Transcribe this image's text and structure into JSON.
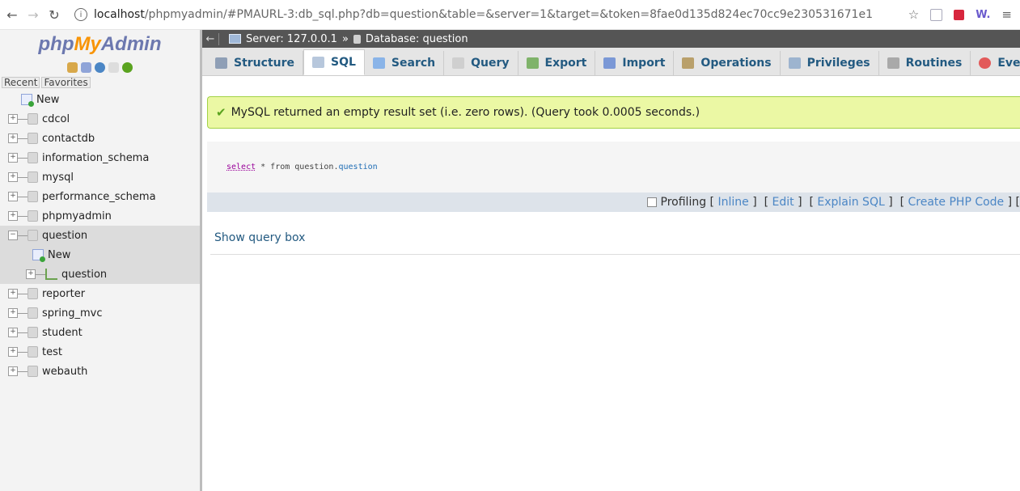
{
  "browser": {
    "host": "localhost",
    "path": "/phpmyadmin/#PMAURL-3:db_sql.php?db=question&table=&server=1&target=&token=8fae0d135d824ec70cc9e230531671e1",
    "w_label": "W."
  },
  "logo": {
    "php": "php",
    "my": "My",
    "admin": "Admin"
  },
  "left": {
    "recent": "Recent",
    "favorites": "Favorites",
    "new": "New",
    "dbs_top": [
      "cdcol",
      "contactdb",
      "information_schema",
      "mysql",
      "performance_schema",
      "phpmyadmin"
    ],
    "expanded_db": "question",
    "expanded_children": {
      "new": "New",
      "table": "question"
    },
    "dbs_bottom": [
      "reporter",
      "spring_mvc",
      "student",
      "test",
      "webauth"
    ]
  },
  "breadcrumb": {
    "server": "Server: 127.0.0.1",
    "sep": "»",
    "database": "Database: question"
  },
  "tabs": [
    {
      "label": "Structure",
      "color": "#8f9fb6"
    },
    {
      "label": "SQL",
      "color": "#b7c7dc"
    },
    {
      "label": "Search",
      "color": "#8ab4e8"
    },
    {
      "label": "Query",
      "color": "#cfcfcf"
    },
    {
      "label": "Export",
      "color": "#7fb36a"
    },
    {
      "label": "Import",
      "color": "#7b98d6"
    },
    {
      "label": "Operations",
      "color": "#b9a06b"
    },
    {
      "label": "Privileges",
      "color": "#9db4cf"
    },
    {
      "label": "Routines",
      "color": "#a9a9a9"
    },
    {
      "label": "Events",
      "color": "#e25a5a"
    }
  ],
  "message": "MySQL returned an empty result set (i.e. zero rows). (Query took 0.0005 seconds.)",
  "query": {
    "kw": "select",
    "mid": " * from question.",
    "ident": "question"
  },
  "profiling": {
    "label": "Profiling",
    "links": [
      "Inline",
      "Edit",
      "Explain SQL",
      "Create PHP Code"
    ]
  },
  "show_query_box": "Show query box"
}
